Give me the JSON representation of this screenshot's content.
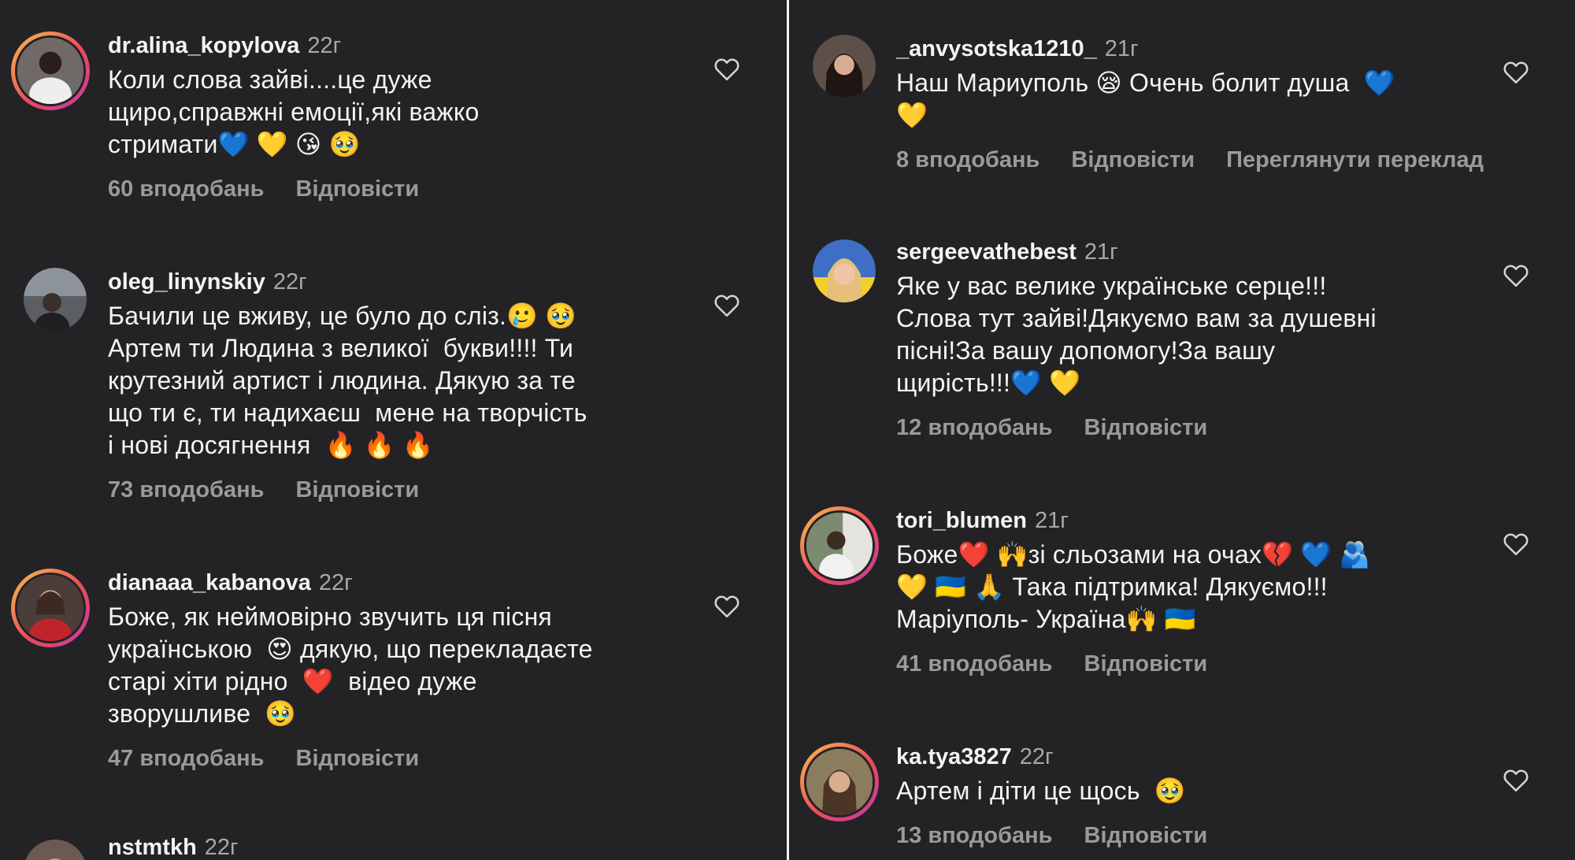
{
  "left_panel": {
    "comments": [
      {
        "username": "dr.alina_kopylova",
        "time": "22г",
        "text": "Коли слова зайві....це дуже\nщиро,справжні емоції,які важко\nстримати💙 💛 😘 🥹",
        "likes": "60 вподобань",
        "reply": "Відповісти"
      },
      {
        "username": "oleg_linynskiy",
        "time": "22г",
        "text": "Бачили це вживу, це було до сліз.🥲 🥹\nАртем ти Людина з великої  букви!!!! Ти\nкрутезний артист і людина. Дякую за те\nщо ти є, ти надихаєш  мене на творчість\nі нові досягнення  🔥 🔥 🔥",
        "likes": "73 вподобань",
        "reply": "Відповісти"
      },
      {
        "username": "dianaaa_kabanova",
        "time": "22г",
        "text": "Боже, як неймовірно звучить ця пісня\nукраїнською  😍 дякую, що перекладаєте\nстарі хіти рідно  ❤️  відео дуже\nзворушливе  🥹",
        "likes": "47 вподобань",
        "reply": "Відповісти"
      },
      {
        "username": "nstmtkh",
        "time": "22г",
        "text": "",
        "likes": "",
        "reply": ""
      }
    ]
  },
  "right_panel": {
    "comments": [
      {
        "username": "_anvysotska1210_",
        "time": "21г",
        "text": "Наш Мариуполь 😪 Очень болит душа  💙\n💛",
        "likes": "8 вподобань",
        "reply": "Відповісти",
        "translate": "Переглянути переклад"
      },
      {
        "username": "sergeevathebest",
        "time": "21г",
        "text": "Яке у вас велике українське серце!!!\nСлова тут зайві!Дякуємо вам за душевні\nпісні!За вашу допомогу!За вашу\nщирість!!!💙 💛",
        "likes": "12 вподобань",
        "reply": "Відповісти"
      },
      {
        "username": "tori_blumen",
        "time": "21г",
        "text": "Боже❤️ 🙌зі сльозами на очах💔 💙 🫂\n💛 🇺🇦 🙏 Така підтримка! Дякуємо!!!\nМаріуполь- Україна🙌 🇺🇦",
        "likes": "41 вподобань",
        "reply": "Відповісти"
      },
      {
        "username": "ka.tya3827",
        "time": "22г",
        "text": "Артем і діти це щось  🥹",
        "likes": "13 вподобань",
        "reply": "Відповісти"
      }
    ]
  },
  "colors": {
    "background": "#232326",
    "divider": "#f2f2f2",
    "text_primary": "#f4f4f4",
    "text_secondary": "#9a9a9a",
    "story_ring": "#ee4a5b"
  }
}
